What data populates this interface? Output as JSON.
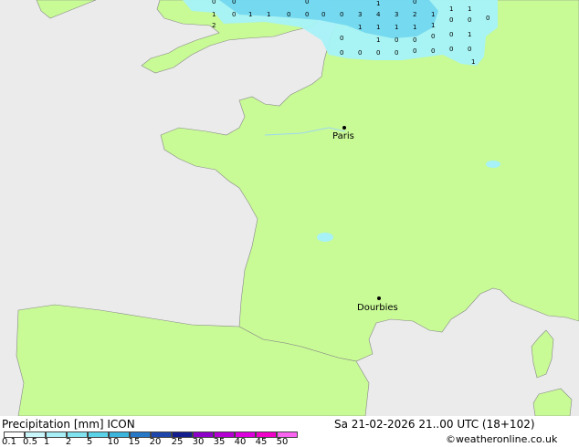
{
  "map": {
    "cities": [
      {
        "name": "Paris"
      },
      {
        "name": "Dourbies"
      }
    ],
    "numbers": [
      "1",
      "0",
      "1",
      "1",
      "0",
      "0",
      "0",
      "0",
      "3",
      "4",
      "3",
      "2",
      "1",
      "1",
      "1",
      "0",
      "2",
      "1",
      "1",
      "1",
      "1",
      "1",
      "0",
      "0",
      "0",
      "1",
      "0",
      "0",
      "0",
      "0",
      "1",
      "0",
      "0",
      "0",
      "0",
      "0",
      "0",
      "0",
      "0",
      "1",
      "0",
      "0",
      "0",
      "1",
      "0"
    ],
    "colors": {
      "land": "#c8fa96",
      "sea": "#ebebeb",
      "precip_light": "#a6f2f8",
      "precip_mid": "#6fd6ef"
    }
  },
  "legend": {
    "title": "Precipitation [mm]  ICON",
    "datetime": "Sa 21-02-2026 21..00 UTC (18+102)",
    "credit": "©weatheronline.co.uk",
    "ticks": [
      "0.1",
      "0.5",
      "1",
      "2",
      "5",
      "10",
      "15",
      "20",
      "25",
      "30",
      "35",
      "40",
      "45",
      "50"
    ],
    "colors": [
      "#ffffff",
      "#c8f6fa",
      "#a6eff6",
      "#82e3f0",
      "#5ad2e8",
      "#3cb4dc",
      "#2878c8",
      "#1e46aa",
      "#141e8c",
      "#8c00c8",
      "#b400d2",
      "#dc00dc",
      "#f000c8",
      "#f864f0"
    ]
  }
}
